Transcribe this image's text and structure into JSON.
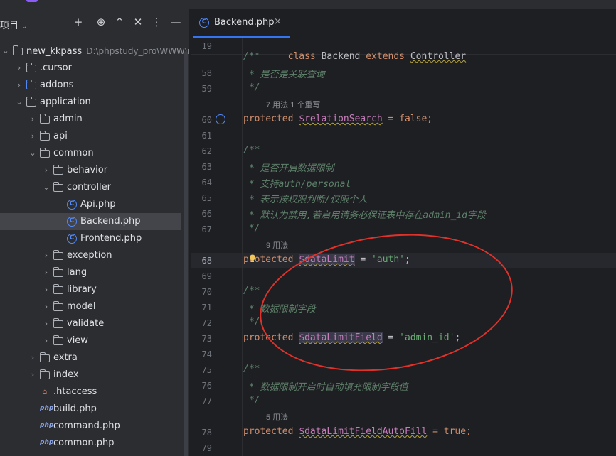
{
  "project": {
    "title": "项目",
    "tree": [
      {
        "label": "new_kkpass",
        "hint": "D:\\phpstudy_pro\\WWW\\ne",
        "type": "folder",
        "expanded": true
      },
      {
        "label": ".cursor",
        "type": "folder",
        "expanded": false
      },
      {
        "label": "addons",
        "type": "folder-blue",
        "expanded": false
      },
      {
        "label": "application",
        "type": "folder",
        "expanded": true
      },
      {
        "label": "admin",
        "type": "folder",
        "expanded": false
      },
      {
        "label": "api",
        "type": "folder",
        "expanded": false
      },
      {
        "label": "common",
        "type": "folder",
        "expanded": true
      },
      {
        "label": "behavior",
        "type": "folder",
        "expanded": false
      },
      {
        "label": "controller",
        "type": "folder",
        "expanded": true
      },
      {
        "label": "Api.php",
        "type": "class"
      },
      {
        "label": "Backend.php",
        "type": "class",
        "selected": true
      },
      {
        "label": "Frontend.php",
        "type": "class"
      },
      {
        "label": "exception",
        "type": "folder",
        "expanded": false
      },
      {
        "label": "lang",
        "type": "folder",
        "expanded": false
      },
      {
        "label": "library",
        "type": "folder",
        "expanded": false
      },
      {
        "label": "model",
        "type": "folder",
        "expanded": false
      },
      {
        "label": "validate",
        "type": "folder",
        "expanded": false
      },
      {
        "label": "view",
        "type": "folder",
        "expanded": false
      },
      {
        "label": "extra",
        "type": "folder",
        "expanded": false
      },
      {
        "label": "index",
        "type": "folder",
        "expanded": false
      },
      {
        "label": ".htaccess",
        "type": "htaccess"
      },
      {
        "label": "build.php",
        "type": "php"
      },
      {
        "label": "command.php",
        "type": "php"
      },
      {
        "label": "common.php",
        "type": "php"
      }
    ]
  },
  "editor": {
    "tab_label": "Backend.php",
    "sticky": {
      "ln": "19",
      "class_kw": "class",
      "class_name": "Backend",
      "extends_kw": "extends",
      "parent": "Controller"
    },
    "lines": {
      "l57": {
        "ln": "",
        "text": "/**"
      },
      "l58": {
        "ln": "58",
        "text": " * 是否是关联查询"
      },
      "l59": {
        "ln": "59",
        "text": " */"
      },
      "h1": "7 用法   1 个重写",
      "l60": {
        "ln": "60",
        "kw": "protected",
        "var": "$relationSearch",
        "rest": " = false;"
      },
      "l61": {
        "ln": "61"
      },
      "l62": {
        "ln": "62",
        "text": "/**"
      },
      "l63": {
        "ln": "63",
        "text": " * 是否开启数据限制"
      },
      "l64": {
        "ln": "64",
        "text": " * 支持auth/personal"
      },
      "l65": {
        "ln": "65",
        "text": " * 表示按权限判断/仅限个人"
      },
      "l66": {
        "ln": "66",
        "text": " * 默认为禁用,若启用请务必保证表中存在admin_id字段"
      },
      "l67": {
        "ln": "67",
        "text": " */"
      },
      "h2": "9 用法",
      "l68": {
        "ln": "68",
        "kw": "protected",
        "var": "$dataLimit",
        "eq": " = ",
        "str": "'auth'",
        "end": ";"
      },
      "l69": {
        "ln": "69"
      },
      "l70": {
        "ln": "70",
        "text": "/**"
      },
      "l71": {
        "ln": "71",
        "text": " * 数据限制字段"
      },
      "l72": {
        "ln": "72",
        "text": " */"
      },
      "l73": {
        "ln": "73",
        "kw": "protected",
        "var": "$dataLimitField",
        "eq": " = ",
        "str": "'admin_id'",
        "end": ";"
      },
      "l74": {
        "ln": "74"
      },
      "l75": {
        "ln": "75",
        "text": "/**"
      },
      "l76": {
        "ln": "76",
        "text": " * 数据限制开启时自动填充限制字段值"
      },
      "l77": {
        "ln": "77",
        "text": " */"
      },
      "h3": "5 用法",
      "l78": {
        "ln": "78",
        "kw": "protected",
        "var": "$dataLimitFieldAutoFill",
        "rest": " = true;"
      },
      "l79": {
        "ln": "79"
      }
    }
  },
  "colors": {
    "accent": "#3574f0",
    "annotation": "#e0312a"
  }
}
